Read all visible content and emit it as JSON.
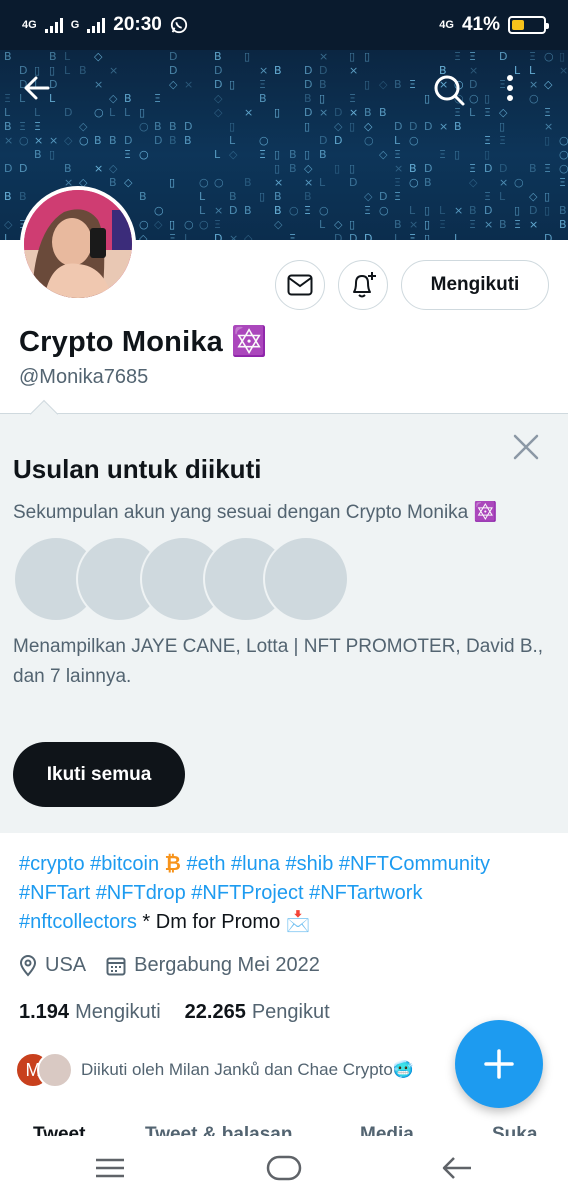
{
  "status_bar": {
    "network_left": "4G",
    "network_mid": "G",
    "time": "20:30",
    "network_right": "4G",
    "battery": "41%",
    "battery_level": 0.41
  },
  "profile": {
    "name": "Crypto Monika 🔯",
    "handle": "@Monika7685",
    "follow_button": "Mengikuti"
  },
  "suggestions": {
    "title": "Usulan untuk diikuti",
    "subtitle": "Sekumpulan akun yang sesuai dengan Crypto Monika 🔯",
    "showing": "Menampilkan JAYE CANE, Lotta | NFT PROMOTER, David B., dan 7 lainnya.",
    "follow_all": "Ikuti semua"
  },
  "bio": {
    "tags_line1": [
      "#crypto",
      "#bitcoin"
    ],
    "bitcoin_emoji": "₿",
    "tags_line1b": [
      "#eth",
      "#luna",
      "#shib",
      "#NFTCommunity"
    ],
    "tags_line2": [
      "#NFTart",
      "#NFTdrop",
      "#NFTProject",
      "#NFTartwork"
    ],
    "tags_line3": [
      "#nftcollectors"
    ],
    "text": "* Dm for Promo 📩"
  },
  "meta": {
    "location": "USA",
    "joined": "Bergabung Mei 2022"
  },
  "stats": {
    "following_count": "1.194",
    "following_label": "Mengikuti",
    "followers_count": "22.265",
    "followers_label": "Pengikut"
  },
  "followed_by": {
    "avatar_letter": "M",
    "text": "Diikuti oleh Milan Janků dan Chae Crypto🥶"
  },
  "tabs": [
    "Tweet",
    "Tweet & balasan",
    "Media",
    "Suka"
  ],
  "colors": {
    "accent": "#1d9bf0",
    "banner": "#0d3559",
    "avatar_m": "#c8401d"
  }
}
